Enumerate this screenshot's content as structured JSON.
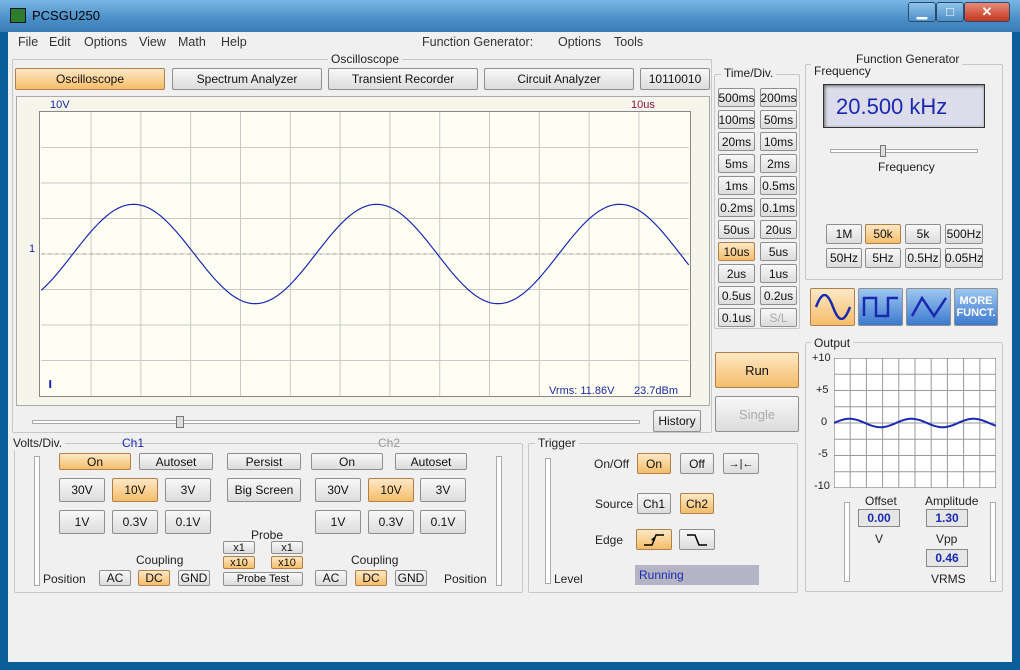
{
  "window": {
    "title": "PCSGU250",
    "min": "▁",
    "max": "□",
    "close": "✕"
  },
  "menu": {
    "items": [
      "File",
      "Edit",
      "Options",
      "View",
      "Math",
      "Help"
    ],
    "fg_label": "Function Generator:",
    "fg_options": "Options",
    "fg_tools": "Tools"
  },
  "oscilloscope": {
    "group_label": "Oscilloscope",
    "tabs": [
      "Oscilloscope",
      "Spectrum Analyzer",
      "Transient Recorder",
      "Circuit Analyzer",
      "10110010"
    ],
    "volts_scale": "10V",
    "time_scale": "10us",
    "marker": "1",
    "vrms": "Vrms: 11.86V",
    "dbm": "23.7dBm",
    "history": "History",
    "waveform": {
      "type": "sine",
      "frequency_khz": 20.5,
      "amplitude_div": 1.4
    }
  },
  "timediv": {
    "label": "Time/Div.",
    "buttons": [
      "500ms",
      "200ms",
      "100ms",
      "50ms",
      "20ms",
      "10ms",
      "5ms",
      "2ms",
      "1ms",
      "0.5ms",
      "0.2ms",
      "0.1ms",
      "50us",
      "20us",
      "10us",
      "5us",
      "2us",
      "1us",
      "0.5us",
      "0.2us",
      "0.1us",
      "S/L"
    ],
    "selected": "10us",
    "disabled": "S/L",
    "run": "Run",
    "single": "Single"
  },
  "voltsdiv": {
    "label": "Volts/Div.",
    "ch1": "Ch1",
    "ch2": "Ch2",
    "on": "On",
    "autoset": "Autoset",
    "persist": "Persist",
    "big_screen": "Big Screen",
    "ranges": [
      "30V",
      "10V",
      "3V",
      "1V",
      "0.3V",
      "0.1V"
    ],
    "selected": "10V",
    "probe": "Probe",
    "x1": "x1",
    "x10": "x10",
    "probe_test": "Probe Test",
    "coupling": "Coupling",
    "ac": "AC",
    "dc": "DC",
    "gnd": "GND",
    "position": "Position"
  },
  "trigger": {
    "label": "Trigger",
    "onoff": "On/Off",
    "on": "On",
    "off": "Off",
    "source": "Source",
    "ch1": "Ch1",
    "ch2": "Ch2",
    "edge": "Edge",
    "level": "Level",
    "status": "Running"
  },
  "fgen": {
    "label": "Function Generator",
    "freq_label": "Frequency",
    "display": "20.500 kHz",
    "slider_label": "Frequency",
    "ranges": [
      "1M",
      "50k",
      "5k",
      "500Hz",
      "50Hz",
      "5Hz",
      "0.5Hz",
      "0.05Hz"
    ],
    "selected_range": "50k",
    "more": "MORE FUNCT.",
    "output_label": "Output",
    "y_ticks": [
      "+10",
      "+5",
      "0",
      "-5",
      "-10"
    ],
    "offset_label": "Offset",
    "offset": "0.00",
    "offset_unit": "V",
    "amp_label": "Amplitude",
    "amplitude": "1.30",
    "amp_unit": "Vpp",
    "vrms_value": "0.46",
    "vrms_unit": "VRMS"
  }
}
